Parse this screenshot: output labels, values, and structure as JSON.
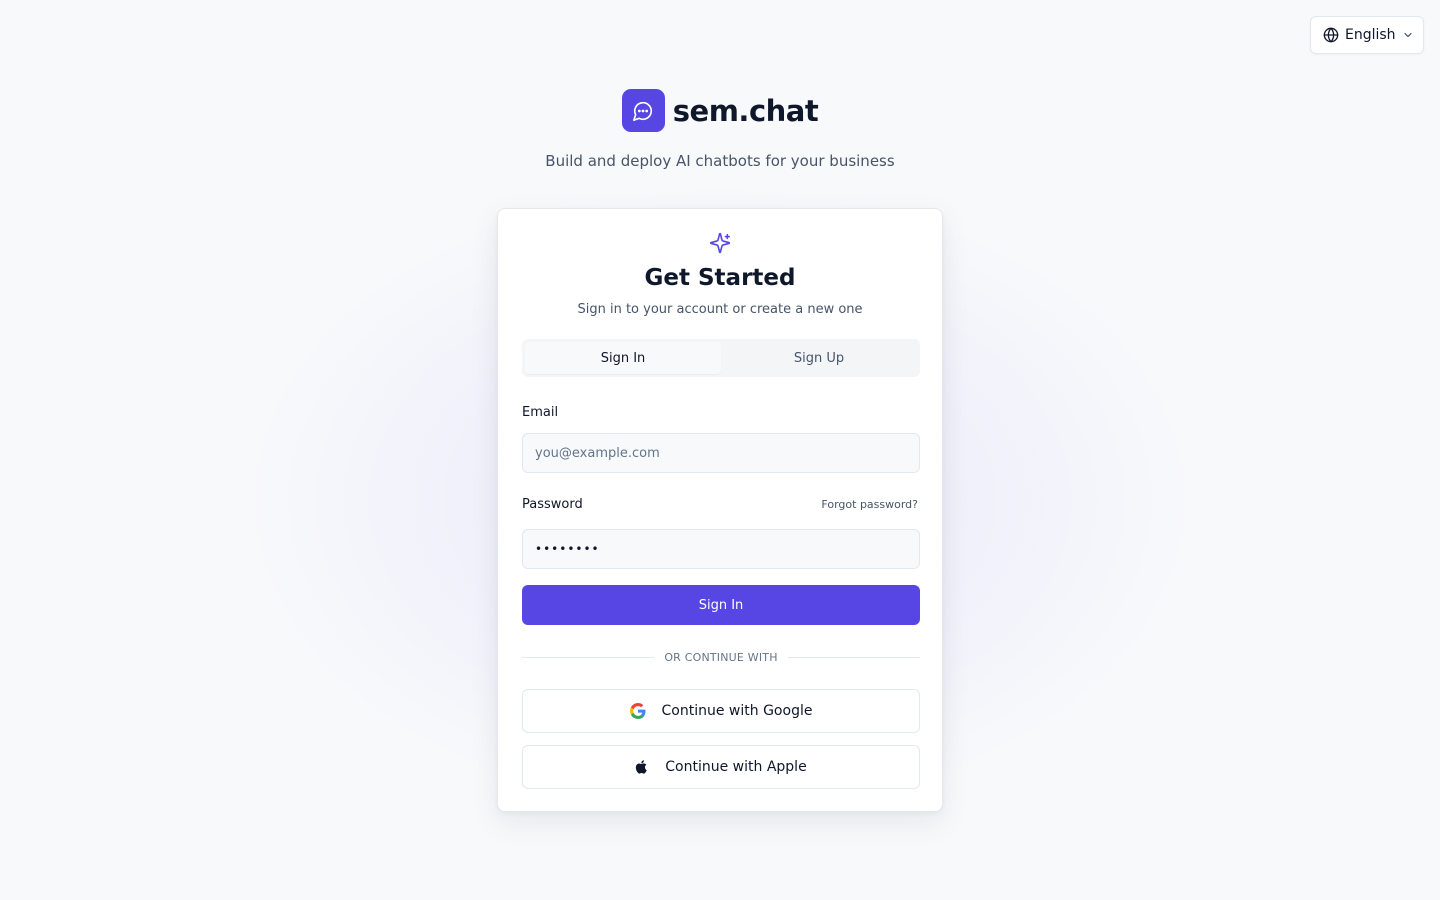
{
  "language": {
    "selected": "English",
    "icon": "globe-icon"
  },
  "brand": {
    "name": "sem.chat",
    "icon": "chat-bubble-icon",
    "accent": "#5746e3"
  },
  "tagline": "Build and deploy AI chatbots for your business",
  "card": {
    "icon": "sparkle-icon",
    "title": "Get Started",
    "subtitle": "Sign in to your account or create a new one",
    "tabs": [
      {
        "label": "Sign In",
        "active": true
      },
      {
        "label": "Sign Up",
        "active": false
      }
    ],
    "email": {
      "label": "Email",
      "placeholder": "you@example.com",
      "value": ""
    },
    "password": {
      "label": "Password",
      "value": "••••••••",
      "forgot_label": "Forgot password?"
    },
    "submit_label": "Sign In",
    "divider_label": "OR CONTINUE WITH",
    "oauth": [
      {
        "label": "Continue with Google",
        "icon": "google-icon"
      },
      {
        "label": "Continue with Apple",
        "icon": "apple-icon"
      }
    ]
  }
}
